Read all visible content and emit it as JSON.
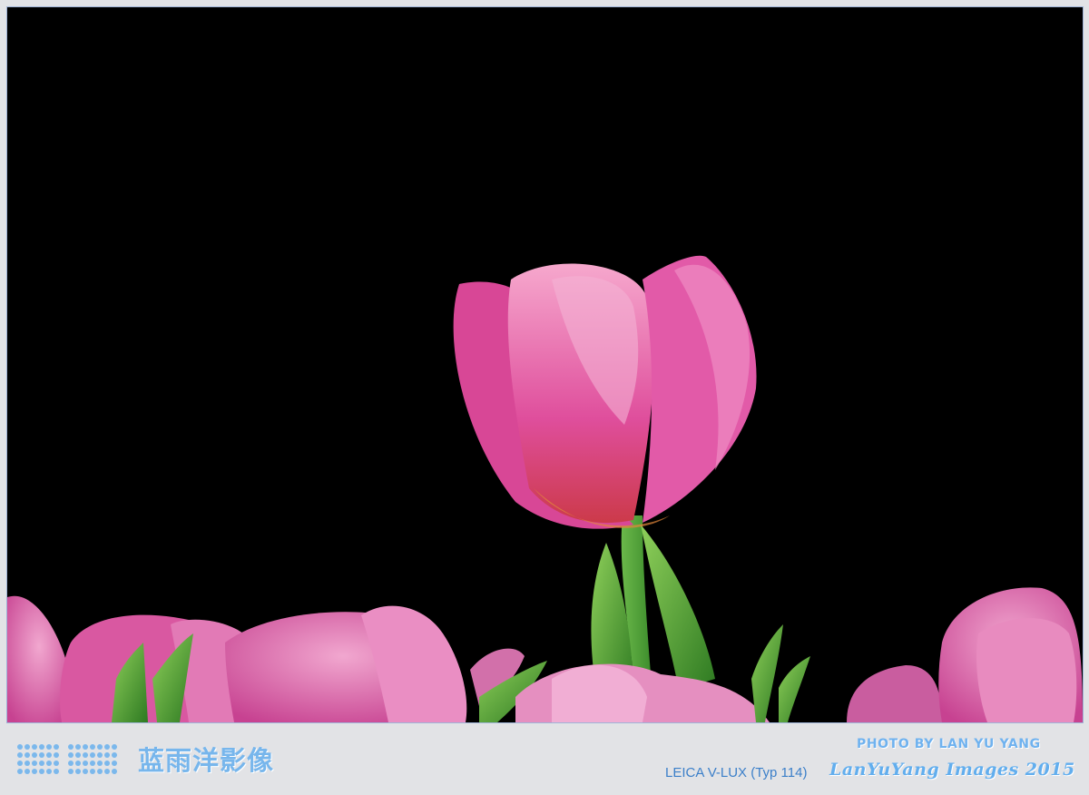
{
  "photo": {
    "subject-icon": "pink-tulip-icon"
  },
  "footer": {
    "brand_cn": "蓝雨洋影像",
    "photo_credit": "PHOTO BY LAN YU YANG",
    "camera_model": "LEICA V-LUX (Typ 114)",
    "signature": "LanYuYang Images 2015"
  },
  "colors": {
    "background": "#000000",
    "tulip_pink": "#e15aa4",
    "leaf_green": "#3f9a2f",
    "footer_text": "#6fb2ef",
    "border": "#9fb4d8"
  }
}
